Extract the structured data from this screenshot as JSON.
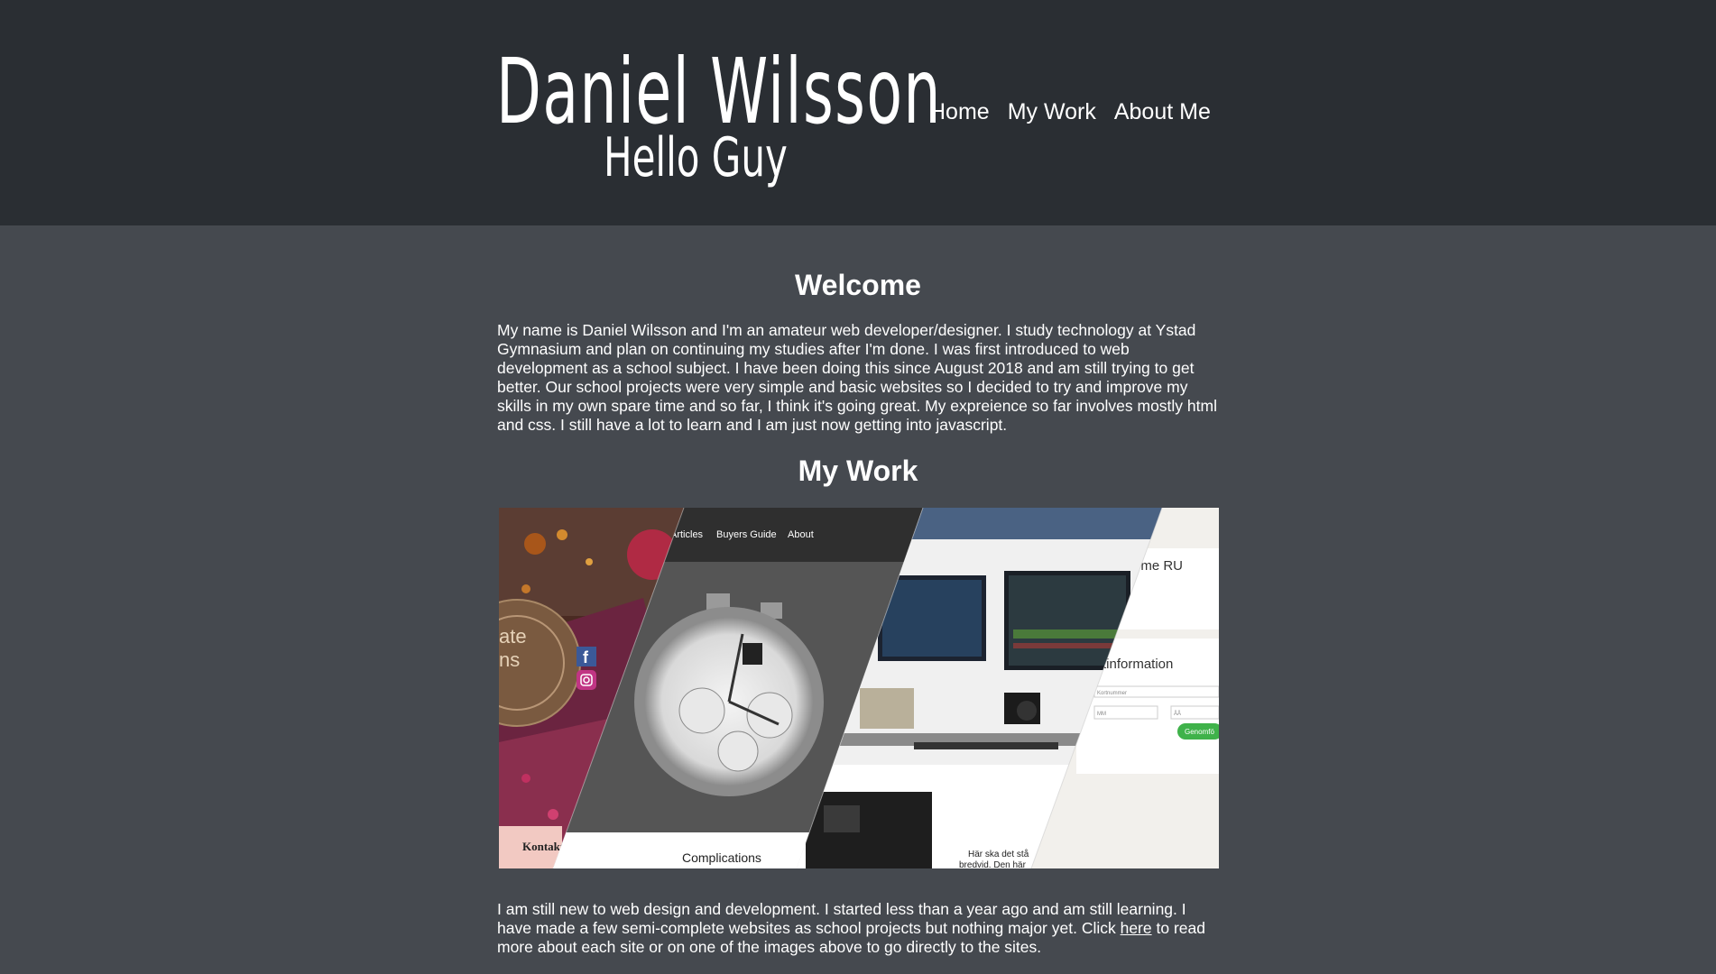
{
  "header": {
    "title": "Daniel Wilsson",
    "tagline": "Hello Guy"
  },
  "nav": {
    "items": [
      {
        "label": "Home"
      },
      {
        "label": "My Work"
      },
      {
        "label": "About Me"
      }
    ]
  },
  "welcome": {
    "title": "Welcome",
    "text": "My name is Daniel Wilsson and I'm an amateur web developer/designer. I study technology at Ystad Gymnasium and plan on continuing my studies after I'm done. I was first introduced to web development as a school subject. I have been doing this since August 2018 and am still trying to get better. Our school projects were very simple and basic websites so I decided to try and improve my skills in my own spare time and so far, I think it's going great. My expreience so far involves mostly html and css. I still have a lot to learn and I am just now getting into javascript."
  },
  "work": {
    "title": "My Work",
    "collage": {
      "panel1": {
        "text_a": "ate",
        "text_b": "ns",
        "button": "Kontakt"
      },
      "panel2": {
        "nav": [
          "Articles",
          "Buyers Guide",
          "About"
        ],
        "caption": "Complications"
      },
      "panel3": {
        "caption_line1": "Här ska det stå",
        "caption_line2": "bredvid. Den här"
      },
      "panel4": {
        "heading1": "ome RU",
        "heading2": "rtinformation",
        "field1": "Kortnummer",
        "field2": "MM",
        "field3": "ÅÅ",
        "button": "Genomfö"
      }
    }
  },
  "footer": {
    "text_before": "I am still new to web design and development. I started less than a year ago and am still learning. I have made a few semi-complete websites as school projects but nothing major yet. Click ",
    "link": "here",
    "text_after": " to read more about each site or on one of the images above to go directly to the sites."
  },
  "colors": {
    "header_bg": "#2a2e33",
    "page_bg": "#45494f",
    "text": "#ffffff"
  }
}
